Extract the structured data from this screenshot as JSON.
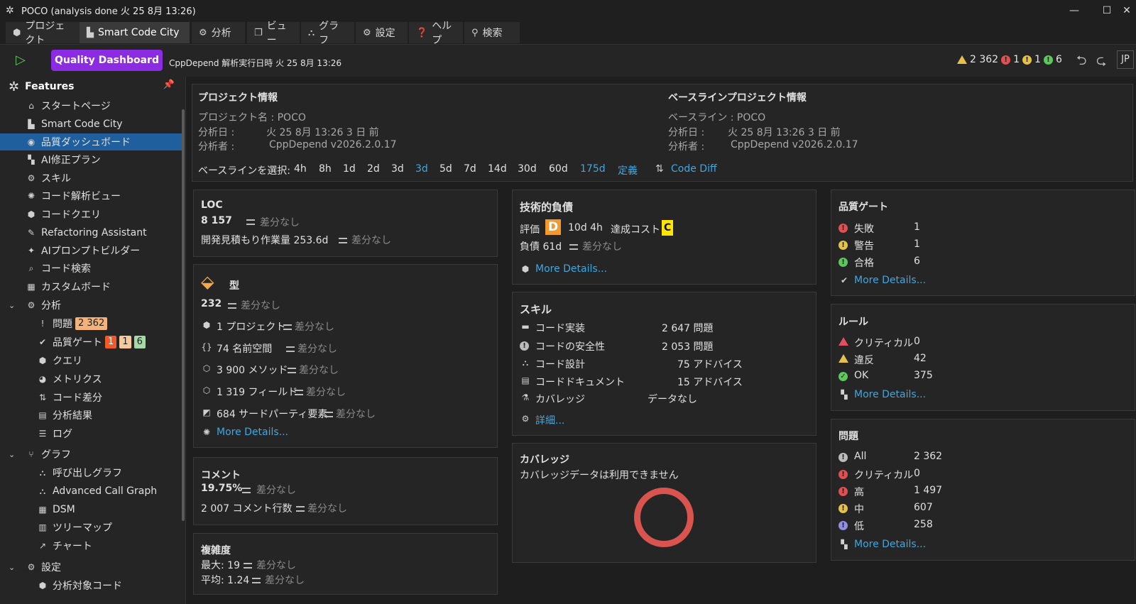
{
  "window": {
    "title": "POCO (analysis done 火 25 8月  13:26)"
  },
  "menu": [
    {
      "icon": "cube-icon",
      "label": "プロジェクト"
    },
    {
      "icon": "city-icon",
      "label": "Smart Code City"
    },
    {
      "icon": "analysis-icon",
      "label": "分析"
    },
    {
      "icon": "view-icon",
      "label": "ビュー"
    },
    {
      "icon": "graph-icon",
      "label": "グラフ"
    },
    {
      "icon": "gear-icon",
      "label": "設定"
    },
    {
      "icon": "help-icon",
      "label": "ヘルプ"
    },
    {
      "icon": "search-icon",
      "label": "検索"
    }
  ],
  "toolbar": {
    "dashboard_label": "Quality Dashboard",
    "subtitle": "CppDepend 解析実行日時 火 25 8月  13:26",
    "warnings": "2 362",
    "red_count": "1",
    "yellow_count": "1",
    "green_count": "6",
    "lang": "JP"
  },
  "sidebar": {
    "title": "Features",
    "items": [
      {
        "label": "スタートページ",
        "icon": "home-icon"
      },
      {
        "label": "Smart Code City",
        "icon": "city-icon"
      },
      {
        "label": "品質ダッシュボード",
        "icon": "dashboard-icon"
      },
      {
        "label": "AI修正プラン",
        "icon": "ai-plan-icon"
      },
      {
        "label": "スキル",
        "icon": "skill-icon"
      },
      {
        "label": "コード解析ビュー",
        "icon": "code-view-icon"
      },
      {
        "label": "コードクエリ",
        "icon": "query-icon"
      },
      {
        "label": "Refactoring Assistant",
        "icon": "refactor-icon"
      },
      {
        "label": "AIプロンプトビルダー",
        "icon": "prompt-icon"
      },
      {
        "label": "コード検索",
        "icon": "code-search-icon"
      },
      {
        "label": "カスタムボード",
        "icon": "board-icon"
      },
      {
        "label": "分析",
        "icon": "analysis-icon"
      },
      {
        "label": "問題",
        "icon": "issue-icon",
        "badge": "2 362"
      },
      {
        "label": "品質ゲート",
        "icon": "gate-icon",
        "b1": "1",
        "b2": "1",
        "b3": "6"
      },
      {
        "label": "クエリ",
        "icon": "query-icon"
      },
      {
        "label": "メトリクス",
        "icon": "metrics-icon"
      },
      {
        "label": "コード差分",
        "icon": "diff-icon"
      },
      {
        "label": "分析結果",
        "icon": "result-icon"
      },
      {
        "label": "ログ",
        "icon": "log-icon"
      },
      {
        "label": "グラフ",
        "icon": "graph-icon"
      },
      {
        "label": "呼び出しグラフ",
        "icon": "callgraph-icon"
      },
      {
        "label": "Advanced Call Graph",
        "icon": "callgraph-icon"
      },
      {
        "label": "DSM",
        "icon": "dsm-icon"
      },
      {
        "label": "ツリーマップ",
        "icon": "treemap-icon"
      },
      {
        "label": "チャート",
        "icon": "chart-icon"
      },
      {
        "label": "設定",
        "icon": "gear-icon"
      },
      {
        "label": "分析対象コード",
        "icon": "cube-icon"
      }
    ]
  },
  "project": {
    "header": "プロジェクト情報",
    "name": "プロジェクト名 : POCO",
    "date_label": "分析日 :",
    "date_value": "火 25 8月  13:26 3 日 前",
    "by_label": "分析者 :",
    "by_value": "CppDepend v2026.2.0.17"
  },
  "baseline": {
    "header": "ベースラインプロジェクト情報",
    "name": "ベースライン : POCO",
    "date_label": "分析日 :",
    "date_value": "火 25 8月  13:26 3 日 前",
    "by_label": "分析者 :",
    "by_value": "CppDepend v2026.2.0.17",
    "select_label": "ベースラインを選択:",
    "options": [
      "4h",
      "8h",
      "1d",
      "2d",
      "3d",
      "3d",
      "5d",
      "7d",
      "14d",
      "30d",
      "60d",
      "175d",
      "定義"
    ],
    "code_diff": "Code Diff"
  },
  "loc": {
    "header": "LOC",
    "value": "8 157",
    "nodiff": "差分なし",
    "effort": "開発見積もり作業量 253.6d"
  },
  "types": {
    "header": "型",
    "count": "232",
    "nodiff": "差分なし",
    "rows": [
      "1 プロジェクト",
      "74 名前空間",
      "3 900 メソッド",
      "1 319 フィールド",
      "684 サードパーティ要素"
    ],
    "more": "More Details..."
  },
  "comment": {
    "header": "コメント",
    "pct": "19.75%",
    "lines": "2 007 コメント行数",
    "nodiff": "差分なし"
  },
  "complexity": {
    "header": "複雑度",
    "max": "最大: 19",
    "avg": "平均: 1.24",
    "nodiff": "差分なし"
  },
  "debt": {
    "header": "技術的負債",
    "rating_label": "評価",
    "grade": "D",
    "time": "10d  4h",
    "cost_label": "達成コスト",
    "cost_grade": "C",
    "debt": "負債 61d",
    "nodiff": "差分なし",
    "more": "More Details..."
  },
  "skills": {
    "header": "スキル",
    "rows": [
      {
        "label": "コード実装",
        "value": "2 647 問題"
      },
      {
        "label": "コードの安全性",
        "value": "2 053 問題"
      },
      {
        "label": "コード設計",
        "value": "75 アドバイス"
      },
      {
        "label": "コードドキュメント",
        "value": "15 アドバイス"
      },
      {
        "label": "カバレッジ",
        "value": "データなし"
      }
    ],
    "more": "詳細..."
  },
  "coverage": {
    "header": "カバレッジ",
    "msg": "カバレッジデータは利用できません",
    "ring_color": "#d9534f"
  },
  "gate": {
    "header": "品質ゲート",
    "rows": [
      {
        "label": "失敗",
        "value": "1"
      },
      {
        "label": "警告",
        "value": "1"
      },
      {
        "label": "合格",
        "value": "6"
      }
    ],
    "more": "More Details..."
  },
  "rules": {
    "header": "ルール",
    "rows": [
      {
        "label": "クリティカル",
        "value": "0"
      },
      {
        "label": "違反",
        "value": "42"
      },
      {
        "label": "OK",
        "value": "375"
      }
    ],
    "more": "More Details..."
  },
  "issues": {
    "header": "問題",
    "rows": [
      {
        "label": "All",
        "value": "2 362"
      },
      {
        "label": "クリティカル",
        "value": "0"
      },
      {
        "label": "高",
        "value": "1 497"
      },
      {
        "label": "中",
        "value": "607"
      },
      {
        "label": "低",
        "value": "258"
      }
    ],
    "more": "More Details..."
  },
  "colors": {
    "accent": "#8b2be2",
    "link": "#3fa7e0",
    "selected": "#1f5f9e"
  }
}
